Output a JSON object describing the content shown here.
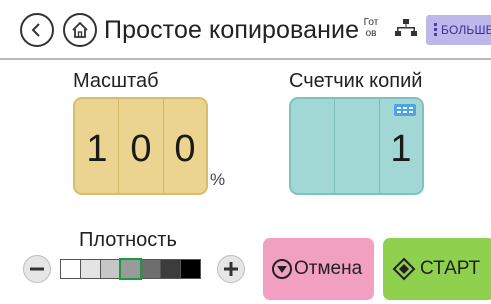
{
  "header": {
    "title": "Простое копирование",
    "status_line1": "Гот",
    "status_line2": "ов",
    "more_label": "БОЛЬШЕ",
    "icons": [
      "back-arrow-icon",
      "home-icon",
      "network-icon",
      "more-dots-icon"
    ]
  },
  "scale": {
    "label": "Масштаб",
    "digits": [
      "1",
      "0",
      "0"
    ],
    "unit": "%"
  },
  "copies": {
    "label": "Счетчик копий",
    "digits": [
      "",
      "",
      "1"
    ],
    "icon": "keypad-icon"
  },
  "density": {
    "label": "Плотность",
    "level": 4,
    "level_count": 7,
    "decrease_icon": "minus-icon",
    "increase_icon": "plus-icon"
  },
  "actions": {
    "cancel_label": "Отмена",
    "start_label": "СТАРТ",
    "colors": {
      "cancel": "#f2a0c1",
      "start": "#8fd04f"
    }
  }
}
